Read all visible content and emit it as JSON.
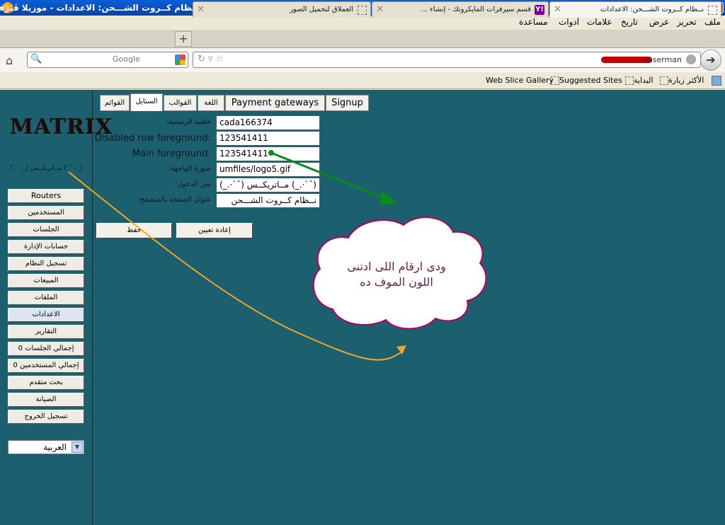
{
  "window": {
    "title": "نــظام كــروت الشـــحن: الاعدادات - موزيلا فَيَرفكس"
  },
  "menu": [
    "ملف",
    "تحرير",
    "عرض",
    "تأريخ",
    "علامات",
    "أدوات",
    "مساعدة"
  ],
  "tabs": [
    {
      "label": "نــظام كــروت الشـــحن: الاعدادات"
    },
    {
      "label": "قسم سيرفرات المايكروتك - إنشاء ..."
    },
    {
      "label": "العملاق لتحميل الصور"
    }
  ],
  "search": {
    "placeholder": "Google"
  },
  "url": {
    "value": "/userman"
  },
  "bookmarks": [
    "الأكثر زيارة",
    "البداية",
    "Suggested Sites",
    "Web Slice Gallery"
  ],
  "logo": {
    "text": "MATRIX",
    "subtitle": "(¯`·._) مــاتريكــس (¯`·._)"
  },
  "sidebar": {
    "items": [
      "Routers",
      "المستخدمين",
      "الجلسات",
      "حسابات الإدارة",
      "تسجيل النظام",
      "المبيعات",
      "الملفات",
      "الاعدادات",
      "التقارير",
      "إجمالي الجلسات 0",
      "إجمالي المستخدمين 0",
      "بحث متقدم",
      "الصيانة",
      "تسجيل الخروج"
    ],
    "selected_index": 7
  },
  "language": {
    "selected": "العربية"
  },
  "page_tabs": [
    "القوائم",
    "الستايل",
    "القوالب",
    "اللغة",
    "Payment gateways",
    "Signup"
  ],
  "form": {
    "fields": [
      {
        "label": ":خلفية الرئيسية",
        "value": "cada166374"
      },
      {
        "label": "Disabled row foreground:",
        "value": "123541411"
      },
      {
        "label": "Main foreground:",
        "value": "123541411"
      },
      {
        "label": ":صورة الواجهة",
        "value": "umfiles/logo5.gif"
      },
      {
        "label": ":نص الدخول",
        "value": "(¯`·._) مــاتريكــس (¯`·._)"
      },
      {
        "label": ":عنوان الصفحة بالمتصفح",
        "value": "نــظام كــروت الشـــحن"
      }
    ],
    "save_label": "حفظ",
    "reset_label": "إعادة تعيين"
  },
  "annotation": {
    "line1": "ودى ارقام اللى ادتنى",
    "line2": "اللون الموف ده",
    "colors": {
      "cloud_fill": "#ffffff",
      "cloud_stroke": "#b3005f",
      "arrow_green": "#0a8a1a",
      "arrow_orange": "#f5a524"
    }
  },
  "colors": {
    "page_bg": "#1c5f6e",
    "titlebar": "#0a5fd8"
  }
}
